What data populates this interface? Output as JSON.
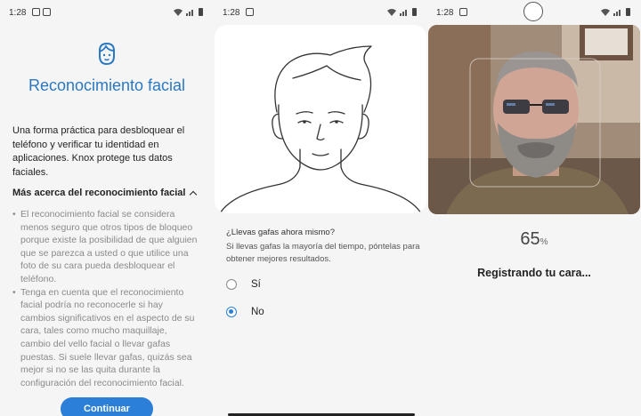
{
  "panel1": {
    "status": {
      "time": "1:28"
    },
    "title": "Reconocimiento facial",
    "intro": "Una forma práctica para desbloquear el teléfono y verificar tu identidad en aplicaciones. Knox protege tus datos faciales.",
    "more_label": "Más acerca del reconocimiento facial",
    "bullets": [
      "El reconocimiento facial se considera menos seguro que otros tipos de bloqueo porque existe la posibilidad de que alguien que se parezca a usted o que utilice una foto de su cara pueda desbloquear el teléfono.",
      "Tenga en cuenta que el reconocimiento facial podría no reconocerle si hay cambios significativos en el aspecto de su cara, tales como mucho maquillaje, cambio del vello facial o llevar gafas puestas. Si suele llevar gafas, quizás sea mejor si no se las quita durante la configuración del reconocimiento facial."
    ],
    "button_label": "Continuar"
  },
  "panel2": {
    "status": {
      "time": "1:28"
    },
    "question": "¿Llevas gafas ahora mismo?",
    "hint": "Si llevas gafas la mayoría del tiempo, póntelas para obtener mejores resultados.",
    "options": [
      {
        "label": "Sí",
        "selected": false
      },
      {
        "label": "No",
        "selected": true
      }
    ]
  },
  "panel3": {
    "status": {
      "time": "1:28"
    },
    "progress_value": "65",
    "progress_unit": "%",
    "status_text": "Registrando tu cara..."
  },
  "colors": {
    "accent": "#2b7fd6",
    "title": "#2a78c2",
    "background": "#f5f5f5"
  },
  "icons": [
    "face-icon",
    "wifi-icon",
    "signal-icon",
    "battery-icon",
    "chevron-up-icon"
  ]
}
